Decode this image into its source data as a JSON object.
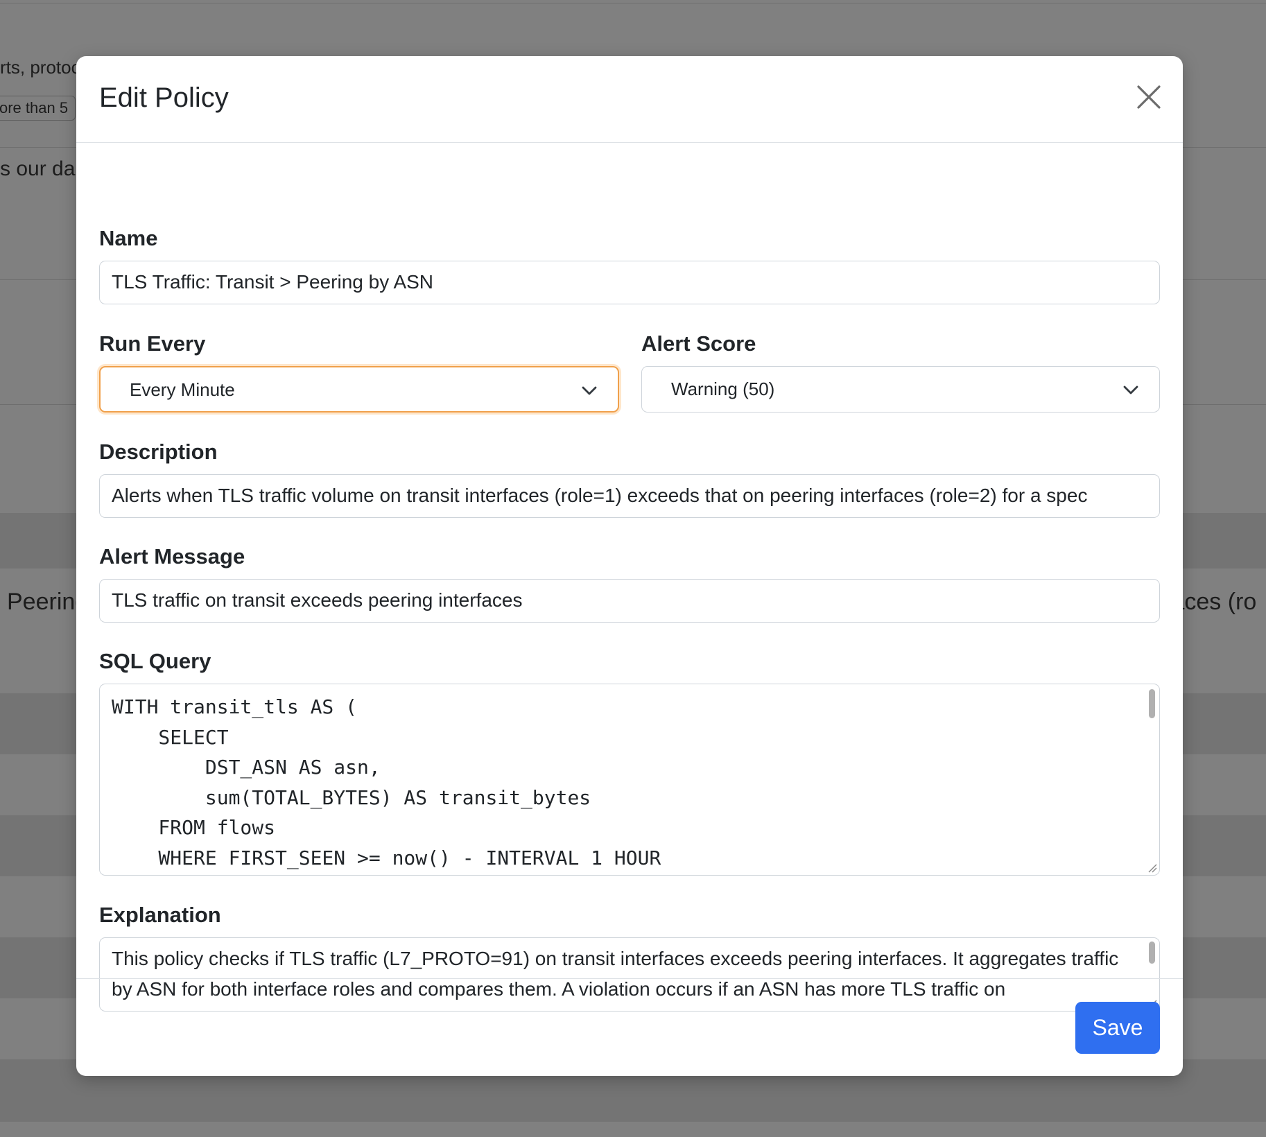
{
  "background": {
    "snippets": [
      "rts, protoc",
      "ore than 5",
      "s our da",
      "Peering",
      "faces (ro"
    ]
  },
  "modal": {
    "title": "Edit Policy",
    "close_label": "×",
    "fields": {
      "name": {
        "label": "Name",
        "value": "TLS Traffic: Transit > Peering by ASN"
      },
      "run_every": {
        "label": "Run Every",
        "value": "Every Minute"
      },
      "alert_score": {
        "label": "Alert Score",
        "value": "Warning (50)"
      },
      "description": {
        "label": "Description",
        "value": "Alerts when TLS traffic volume on transit interfaces (role=1) exceeds that on peering interfaces (role=2) for a spec"
      },
      "alert_message": {
        "label": "Alert Message",
        "value": "TLS traffic on transit exceeds peering interfaces"
      },
      "sql_query": {
        "label": "SQL Query",
        "value": "WITH transit_tls AS (\n    SELECT\n        DST_ASN AS asn,\n        sum(TOTAL_BYTES) AS transit_bytes\n    FROM flows\n    WHERE FIRST_SEEN >= now() - INTERVAL 1 HOUR"
      },
      "explanation": {
        "label": "Explanation",
        "value": "This policy checks if TLS traffic (L7_PROTO=91) on transit interfaces exceeds peering interfaces. It aggregates traffic by ASN for both interface roles and compares them. A violation occurs if an ASN has more TLS traffic on"
      }
    },
    "save_label": "Save"
  },
  "colors": {
    "backdrop": "#808080",
    "primary_button": "#2f6ff0",
    "focus_border": "#f0a04b"
  }
}
